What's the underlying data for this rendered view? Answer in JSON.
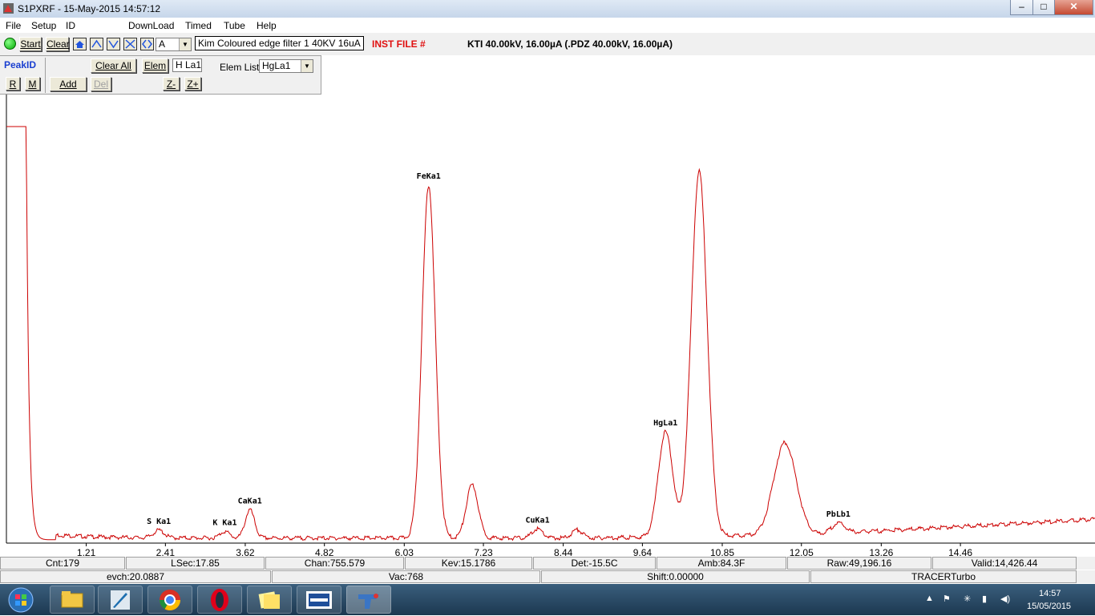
{
  "window": {
    "title": "S1PXRF - 15-May-2015 14:57:12",
    "minimize": "–",
    "maximize": "□",
    "close": "✕"
  },
  "menu": [
    "File",
    "Setup",
    "ID",
    "DownLoad",
    "Timed",
    "Tube",
    "Help"
  ],
  "toolbar": {
    "start": "Start",
    "clear": "Clear",
    "channel_value": "A",
    "sample_name": "Kim Coloured edge filter 1 40KV 16uA",
    "inst_file": "INST FILE #",
    "tube_info": "KTI 40.00kV, 16.00µA (.PDZ 40.00kV, 16.00µA)"
  },
  "peakid": {
    "title": "PeakID",
    "r": "R",
    "m": "M",
    "add": "Add",
    "del": "Del",
    "clear_all": "Clear All",
    "elem": "Elem",
    "elem_value": "H La1",
    "zminus": "Z-",
    "zplus": "Z+",
    "elem_list_label": "Elem List:",
    "elem_list_value": "HgLa1"
  },
  "chart_data": {
    "type": "line",
    "xlabel": "",
    "ylabel": "",
    "x_ticks": [
      "1.21",
      "2.41",
      "3.62",
      "4.82",
      "6.03",
      "7.23",
      "8.44",
      "9.64",
      "10.85",
      "12.05",
      "13.26",
      "14.46"
    ],
    "xlim": [
      0,
      16.5
    ],
    "ylim": [
      0,
      1000
    ],
    "color": "#cc0000",
    "peak_labels": [
      {
        "label": "FeKa1",
        "x": 6.4
      },
      {
        "label": "HgLa1",
        "x": 9.99
      },
      {
        "label": "CaKa1",
        "x": 3.69
      },
      {
        "label": "S Ka1",
        "x": 2.31
      },
      {
        "label": "K Ka1",
        "x": 3.31
      },
      {
        "label": "CuKa1",
        "x": 8.05
      },
      {
        "label": "PbLb1",
        "x": 12.61
      }
    ],
    "peaks": [
      {
        "x": 6.4,
        "h": 848,
        "w": 0.1
      },
      {
        "x": 7.06,
        "h": 128,
        "w": 0.09
      },
      {
        "x": 3.69,
        "h": 68,
        "w": 0.07
      },
      {
        "x": 2.31,
        "h": 18,
        "w": 0.08
      },
      {
        "x": 3.31,
        "h": 16,
        "w": 0.07
      },
      {
        "x": 8.05,
        "h": 22,
        "w": 0.08
      },
      {
        "x": 8.65,
        "h": 20,
        "w": 0.08
      },
      {
        "x": 9.99,
        "h": 252,
        "w": 0.11
      },
      {
        "x": 10.5,
        "h": 878,
        "w": 0.12
      },
      {
        "x": 11.8,
        "h": 222,
        "w": 0.17
      },
      {
        "x": 12.61,
        "h": 24,
        "w": 0.1
      }
    ]
  },
  "status": {
    "row1": [
      "Cnt:179",
      "LSec:17.85",
      "Chan:755.579",
      "Kev:15.1786",
      "Det:-15.5C",
      "Amb:84.3F",
      "Raw:49,196.16",
      "Valid:14,426.44"
    ],
    "row2": [
      "evch:20.0887",
      "Vac:768",
      "Shift:0.00000",
      "TRACERTurbo"
    ]
  },
  "taskbar": {
    "time": "14:57",
    "date": "15/05/2015"
  }
}
